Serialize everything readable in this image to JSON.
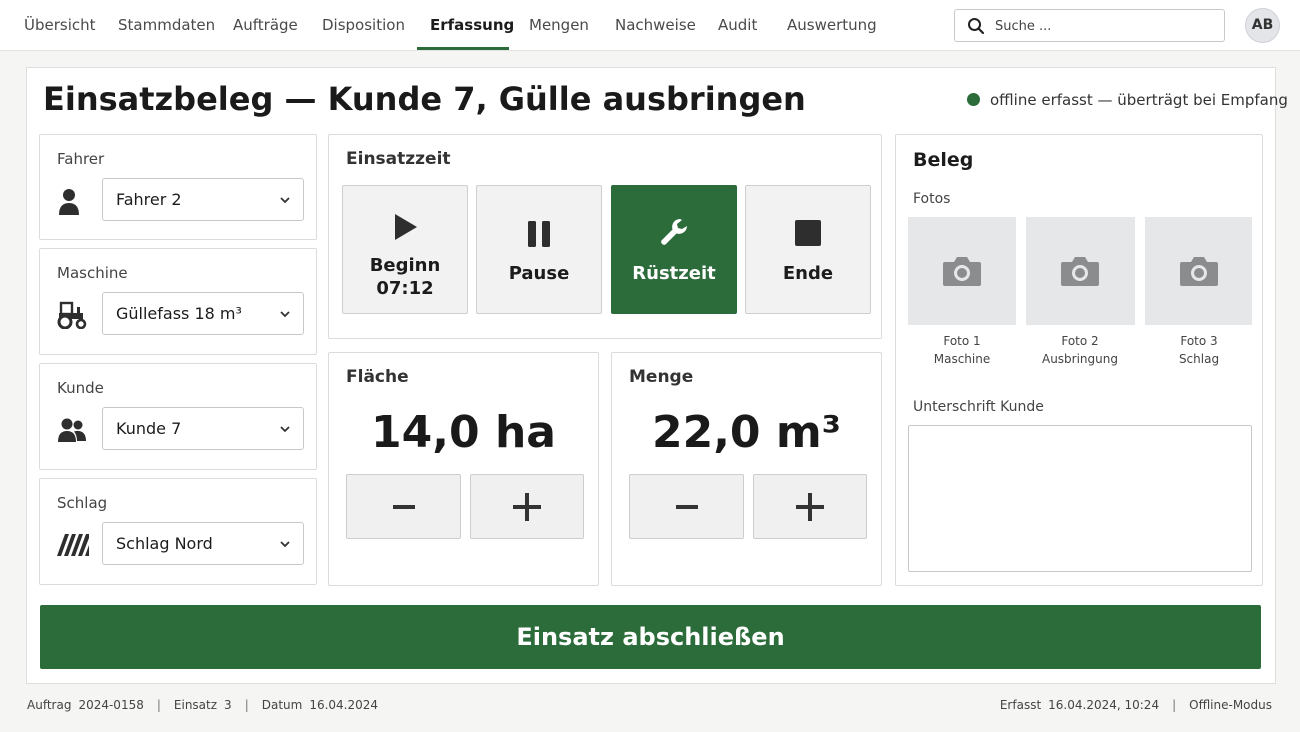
{
  "nav": {
    "tabs": [
      {
        "label": "Übersicht"
      },
      {
        "label": "Stammdaten"
      },
      {
        "label": "Aufträge"
      },
      {
        "label": "Disposition"
      },
      {
        "label": "Erfassung"
      },
      {
        "label": "Mengen"
      },
      {
        "label": "Nachweise"
      },
      {
        "label": "Audit"
      },
      {
        "label": "Auswertung"
      }
    ],
    "active_tab": "Erfassung",
    "search_placeholder": "Suche ...",
    "avatar_initials": "AB"
  },
  "page": {
    "title": "Einsatzbeleg — Kunde 7, Gülle ausbringen",
    "status_text": "offline erfasst — überträgt bei Empfang",
    "status_color": "#2c6b3a"
  },
  "fields": {
    "driver": {
      "label": "Fahrer",
      "value": "Fahrer 2",
      "icon": "person-icon"
    },
    "machine": {
      "label": "Maschine",
      "value": "Güllefass 18 m³",
      "icon": "tractor-icon"
    },
    "customer": {
      "label": "Kunde",
      "value": "Kunde 7",
      "icon": "people-icon"
    },
    "field": {
      "label": "Schlag",
      "value": "Schlag Nord",
      "icon": "field-stripes-icon"
    }
  },
  "time": {
    "title": "Einsatzzeit",
    "buttons": [
      {
        "label": "Beginn",
        "time": "07:12",
        "icon": "play-icon",
        "active": false
      },
      {
        "label": "Pause",
        "icon": "pause-icon",
        "active": false
      },
      {
        "label": "Rüstzeit",
        "icon": "wrench-icon",
        "active": true
      },
      {
        "label": "Ende",
        "icon": "stop-icon",
        "active": false
      }
    ]
  },
  "area": {
    "title": "Fläche",
    "value": "14,0",
    "unit": "ha"
  },
  "quantity": {
    "title": "Menge",
    "value": "22,0",
    "unit": "m³"
  },
  "receipt": {
    "title": "Beleg",
    "photos_label": "Fotos",
    "photos": [
      {
        "line1": "Foto 1",
        "line2": "Maschine"
      },
      {
        "line1": "Foto 2",
        "line2": "Ausbringung"
      },
      {
        "line1": "Foto 3",
        "line2": "Schlag"
      }
    ],
    "signature_label": "Unterschrift Kunde"
  },
  "actions": {
    "finish_label": "Einsatz abschließen"
  },
  "footer": {
    "order_label": "Auftrag",
    "order_value": "2024-0158",
    "deployment_label": "Einsatz",
    "deployment_value": "3",
    "date_label": "Datum",
    "date_value": "16.04.2024",
    "recorded_label": "Erfasst",
    "recorded_value": "16.04.2024, 10:24",
    "mode": "Offline-Modus"
  },
  "colors": {
    "accent": "#2c6b3a",
    "button_bg": "#f2f2f2",
    "photo_bg": "#e6e7e8"
  }
}
